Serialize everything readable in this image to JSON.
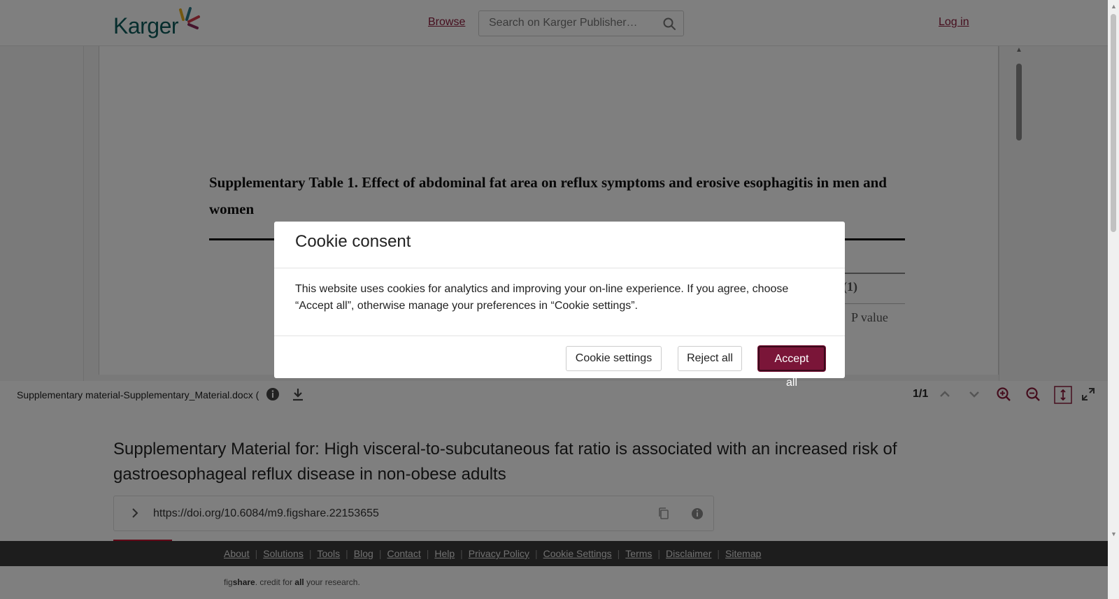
{
  "header": {
    "logo_text": "Karger",
    "browse_label": "Browse",
    "search_placeholder": "Search on Karger Publisher…",
    "login_label": "Log in"
  },
  "document_preview": {
    "title": "Supplementary Table 1. Effect of abdominal fat area on reflux symptoms and erosive esophagitis in men and women",
    "partial_header_1": "(1)",
    "partial_header_2": "P value"
  },
  "viewer_toolbar": {
    "filename": "Supplementary material-Supplementary_Material.docx (",
    "page_indicator": "1/1"
  },
  "content": {
    "title": "Supplementary Material for: High visceral-to-subcutaneous fat ratio is associated with an increased risk of gastroesophageal reflux disease in non-obese adults",
    "doi": "https://doi.org/10.6084/m9.figshare.22153655"
  },
  "footer": {
    "links": [
      "About",
      "Solutions",
      "Tools",
      "Blog",
      "Contact",
      "Help",
      "Privacy Policy",
      "Cookie Settings",
      "Terms",
      "Disclaimer",
      "Sitemap"
    ],
    "credit_prefix": "fig",
    "credit_brand": "share",
    "credit_mid": ". credit for ",
    "credit_all": "all",
    "credit_suffix": " your research."
  },
  "cookie_modal": {
    "title": "Cookie consent",
    "body": "This website uses cookies for analytics and improving your on-line experience. If you agree, choose “Accept all”, otherwise manage your preferences in “Cookie settings”.",
    "settings_label": "Cookie settings",
    "reject_label": "Reject all",
    "accept_label": "Accept all"
  },
  "colors": {
    "brand": "#8b1a3a",
    "accept_button": "#7a1538",
    "logo_teal": "#0c5a5a"
  }
}
